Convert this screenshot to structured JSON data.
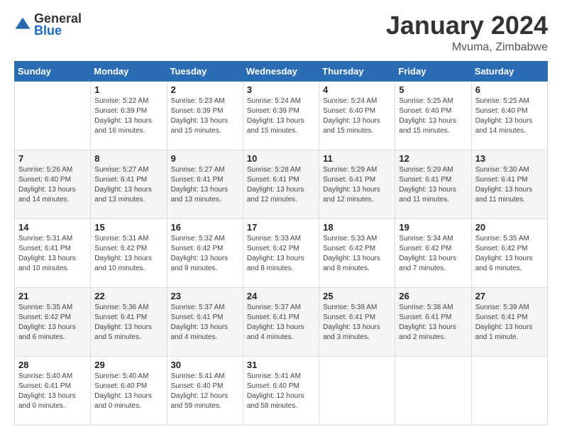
{
  "header": {
    "logo_general": "General",
    "logo_blue": "Blue",
    "title": "January 2024",
    "subtitle": "Mvuma, Zimbabwe"
  },
  "calendar": {
    "days_of_week": [
      "Sunday",
      "Monday",
      "Tuesday",
      "Wednesday",
      "Thursday",
      "Friday",
      "Saturday"
    ],
    "weeks": [
      [
        {
          "day": "",
          "sunrise": "",
          "sunset": "",
          "daylight": ""
        },
        {
          "day": "1",
          "sunrise": "Sunrise: 5:22 AM",
          "sunset": "Sunset: 6:39 PM",
          "daylight": "Daylight: 13 hours and 16 minutes."
        },
        {
          "day": "2",
          "sunrise": "Sunrise: 5:23 AM",
          "sunset": "Sunset: 6:39 PM",
          "daylight": "Daylight: 13 hours and 15 minutes."
        },
        {
          "day": "3",
          "sunrise": "Sunrise: 5:24 AM",
          "sunset": "Sunset: 6:39 PM",
          "daylight": "Daylight: 13 hours and 15 minutes."
        },
        {
          "day": "4",
          "sunrise": "Sunrise: 5:24 AM",
          "sunset": "Sunset: 6:40 PM",
          "daylight": "Daylight: 13 hours and 15 minutes."
        },
        {
          "day": "5",
          "sunrise": "Sunrise: 5:25 AM",
          "sunset": "Sunset: 6:40 PM",
          "daylight": "Daylight: 13 hours and 15 minutes."
        },
        {
          "day": "6",
          "sunrise": "Sunrise: 5:25 AM",
          "sunset": "Sunset: 6:40 PM",
          "daylight": "Daylight: 13 hours and 14 minutes."
        }
      ],
      [
        {
          "day": "7",
          "sunrise": "Sunrise: 5:26 AM",
          "sunset": "Sunset: 6:40 PM",
          "daylight": "Daylight: 13 hours and 14 minutes."
        },
        {
          "day": "8",
          "sunrise": "Sunrise: 5:27 AM",
          "sunset": "Sunset: 6:41 PM",
          "daylight": "Daylight: 13 hours and 13 minutes."
        },
        {
          "day": "9",
          "sunrise": "Sunrise: 5:27 AM",
          "sunset": "Sunset: 6:41 PM",
          "daylight": "Daylight: 13 hours and 13 minutes."
        },
        {
          "day": "10",
          "sunrise": "Sunrise: 5:28 AM",
          "sunset": "Sunset: 6:41 PM",
          "daylight": "Daylight: 13 hours and 12 minutes."
        },
        {
          "day": "11",
          "sunrise": "Sunrise: 5:29 AM",
          "sunset": "Sunset: 6:41 PM",
          "daylight": "Daylight: 13 hours and 12 minutes."
        },
        {
          "day": "12",
          "sunrise": "Sunrise: 5:29 AM",
          "sunset": "Sunset: 6:41 PM",
          "daylight": "Daylight: 13 hours and 11 minutes."
        },
        {
          "day": "13",
          "sunrise": "Sunrise: 5:30 AM",
          "sunset": "Sunset: 6:41 PM",
          "daylight": "Daylight: 13 hours and 11 minutes."
        }
      ],
      [
        {
          "day": "14",
          "sunrise": "Sunrise: 5:31 AM",
          "sunset": "Sunset: 6:41 PM",
          "daylight": "Daylight: 13 hours and 10 minutes."
        },
        {
          "day": "15",
          "sunrise": "Sunrise: 5:31 AM",
          "sunset": "Sunset: 6:42 PM",
          "daylight": "Daylight: 13 hours and 10 minutes."
        },
        {
          "day": "16",
          "sunrise": "Sunrise: 5:32 AM",
          "sunset": "Sunset: 6:42 PM",
          "daylight": "Daylight: 13 hours and 9 minutes."
        },
        {
          "day": "17",
          "sunrise": "Sunrise: 5:33 AM",
          "sunset": "Sunset: 6:42 PM",
          "daylight": "Daylight: 13 hours and 8 minutes."
        },
        {
          "day": "18",
          "sunrise": "Sunrise: 5:33 AM",
          "sunset": "Sunset: 6:42 PM",
          "daylight": "Daylight: 13 hours and 8 minutes."
        },
        {
          "day": "19",
          "sunrise": "Sunrise: 5:34 AM",
          "sunset": "Sunset: 6:42 PM",
          "daylight": "Daylight: 13 hours and 7 minutes."
        },
        {
          "day": "20",
          "sunrise": "Sunrise: 5:35 AM",
          "sunset": "Sunset: 6:42 PM",
          "daylight": "Daylight: 13 hours and 6 minutes."
        }
      ],
      [
        {
          "day": "21",
          "sunrise": "Sunrise: 5:35 AM",
          "sunset": "Sunset: 6:42 PM",
          "daylight": "Daylight: 13 hours and 6 minutes."
        },
        {
          "day": "22",
          "sunrise": "Sunrise: 5:36 AM",
          "sunset": "Sunset: 6:41 PM",
          "daylight": "Daylight: 13 hours and 5 minutes."
        },
        {
          "day": "23",
          "sunrise": "Sunrise: 5:37 AM",
          "sunset": "Sunset: 6:41 PM",
          "daylight": "Daylight: 13 hours and 4 minutes."
        },
        {
          "day": "24",
          "sunrise": "Sunrise: 5:37 AM",
          "sunset": "Sunset: 6:41 PM",
          "daylight": "Daylight: 13 hours and 4 minutes."
        },
        {
          "day": "25",
          "sunrise": "Sunrise: 5:38 AM",
          "sunset": "Sunset: 6:41 PM",
          "daylight": "Daylight: 13 hours and 3 minutes."
        },
        {
          "day": "26",
          "sunrise": "Sunrise: 5:38 AM",
          "sunset": "Sunset: 6:41 PM",
          "daylight": "Daylight: 13 hours and 2 minutes."
        },
        {
          "day": "27",
          "sunrise": "Sunrise: 5:39 AM",
          "sunset": "Sunset: 6:41 PM",
          "daylight": "Daylight: 13 hours and 1 minute."
        }
      ],
      [
        {
          "day": "28",
          "sunrise": "Sunrise: 5:40 AM",
          "sunset": "Sunset: 6:41 PM",
          "daylight": "Daylight: 13 hours and 0 minutes."
        },
        {
          "day": "29",
          "sunrise": "Sunrise: 5:40 AM",
          "sunset": "Sunset: 6:40 PM",
          "daylight": "Daylight: 13 hours and 0 minutes."
        },
        {
          "day": "30",
          "sunrise": "Sunrise: 5:41 AM",
          "sunset": "Sunset: 6:40 PM",
          "daylight": "Daylight: 12 hours and 59 minutes."
        },
        {
          "day": "31",
          "sunrise": "Sunrise: 5:41 AM",
          "sunset": "Sunset: 6:40 PM",
          "daylight": "Daylight: 12 hours and 58 minutes."
        },
        {
          "day": "",
          "sunrise": "",
          "sunset": "",
          "daylight": ""
        },
        {
          "day": "",
          "sunrise": "",
          "sunset": "",
          "daylight": ""
        },
        {
          "day": "",
          "sunrise": "",
          "sunset": "",
          "daylight": ""
        }
      ]
    ]
  }
}
